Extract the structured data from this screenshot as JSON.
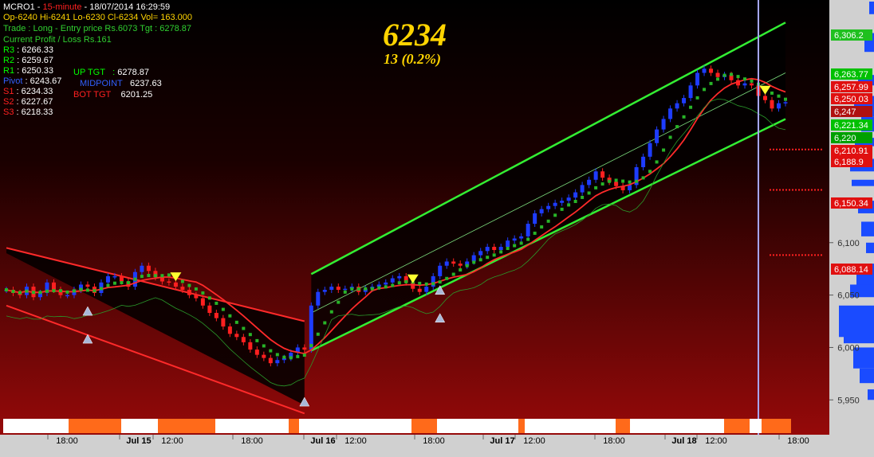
{
  "header": {
    "symbol": "MCRO1",
    "interval": "15-minute",
    "timestamp": "18/07/2014 16:29:59",
    "ohlc": "Op-6240  Hi-6241  Lo-6230  Cl-6234  Vol=  163.000",
    "trade": "Trade : Long - Entry price Rs.6073 Tgt : 6278.87",
    "profit": "Current Profit / Loss Rs.161"
  },
  "levels": [
    {
      "label": "R3",
      "value": "6266.33",
      "color": "#00ff00"
    },
    {
      "label": "R2",
      "value": "6259.67",
      "color": "#00ff00"
    },
    {
      "label": "R1",
      "value": "6250.33",
      "color": "#00ff00"
    },
    {
      "label": "Pivot",
      "value": "6243.67",
      "color": "#3060ff"
    },
    {
      "label": "S1",
      "value": "6234.33",
      "color": "#ff2020"
    },
    {
      "label": "S2",
      "value": "6227.67",
      "color": "#ff2020"
    },
    {
      "label": "S3",
      "value": "6218.33",
      "color": "#ff2020"
    }
  ],
  "targets": {
    "up_label": "UP TGT",
    "up_value": "6278.87",
    "mid_label": "MIDPOINT",
    "mid_value": "6237.63",
    "bot_label": "BOT TGT",
    "bot_value": "6201.25"
  },
  "last_price": {
    "value": "6234",
    "change": "13  (0.2%)"
  },
  "colors": {
    "background_top": "#000000",
    "background_bottom": "#a00a0a",
    "up_candle": "#1e3cff",
    "down_candle": "#ff2020",
    "channel": "#33ee33",
    "channel_down": "#ff2a2a",
    "volume_profile": "#1a4bff",
    "price_label_text": "#ffffff"
  },
  "chart_data": {
    "type": "line",
    "title": "",
    "y_axis_side": "right",
    "ylim": [
      5935,
      6330
    ],
    "yticks": [
      5950,
      6000,
      6050,
      6100
    ],
    "ytick_labels": [
      "5,950",
      "6,000",
      "6,050",
      "6,100"
    ],
    "x_tick_labels": [
      "18:00",
      "Jul 15",
      "12:00",
      "18:00",
      "Jul 16",
      "12:00",
      "18:00",
      "Jul 17",
      "12:00",
      "18:00",
      "Jul 18",
      "12:00",
      "18:00"
    ],
    "price_labels": [
      {
        "text": "6,306.2",
        "value": 6306.2,
        "color": "#1fc01f"
      },
      {
        "text": "6,263.77",
        "value": 6263.77,
        "color": "#00c000"
      },
      {
        "text": "6,257.99",
        "value": 6257.99,
        "color": "#e01010"
      },
      {
        "text": "6,250.03",
        "value": 6250.03,
        "color": "#e01010"
      },
      {
        "text": "6,247",
        "value": 6247,
        "color": "#b01010"
      },
      {
        "text": "6,221.34",
        "value": 6221.34,
        "color": "#00c000"
      },
      {
        "text": "6,220",
        "value": 6220,
        "color": "#00a000"
      },
      {
        "text": "6,210.91",
        "value": 6210.91,
        "color": "#e01010"
      },
      {
        "text": "6,188.9",
        "value": 6188.9,
        "color": "#e01010"
      },
      {
        "text": "6,150.34",
        "value": 6150.34,
        "color": "#e01010"
      },
      {
        "text": "6,088.14",
        "value": 6088.14,
        "color": "#e01010"
      }
    ],
    "session_start_index": 45,
    "markers": [
      {
        "type": "buy",
        "index": 12
      },
      {
        "type": "buy",
        "index": 12
      },
      {
        "type": "sell",
        "index": 25
      },
      {
        "type": "buy",
        "index": 44
      },
      {
        "type": "sell",
        "index": 60
      },
      {
        "type": "buy",
        "index": 64
      },
      {
        "type": "buy",
        "index": 64
      },
      {
        "type": "sell",
        "index": 112
      }
    ],
    "close": [
      6055,
      6052,
      6050,
      6058,
      6048,
      6052,
      6062,
      6055,
      6050,
      6050,
      6055,
      6060,
      6058,
      6052,
      6062,
      6068,
      6068,
      6063,
      6058,
      6072,
      6078,
      6073,
      6067,
      6063,
      6062,
      6058,
      6055,
      6050,
      6047,
      6040,
      6033,
      6028,
      6020,
      6013,
      6010,
      6005,
      5998,
      5993,
      5990,
      5985,
      5988,
      5990,
      5995,
      6000,
      5998,
      6040,
      6053,
      6055,
      6058,
      6055,
      6056,
      6058,
      6053,
      6056,
      6058,
      6060,
      6062,
      6066,
      6068,
      6062,
      6056,
      6053,
      6058,
      6068,
      6078,
      6082,
      6080,
      6078,
      6082,
      6088,
      6092,
      6096,
      6093,
      6096,
      6102,
      6104,
      6106,
      6118,
      6128,
      6132,
      6135,
      6138,
      6140,
      6143,
      6148,
      6155,
      6160,
      6168,
      6162,
      6158,
      6154,
      6150,
      6155,
      6172,
      6182,
      6195,
      6208,
      6218,
      6228,
      6233,
      6238,
      6250,
      6262,
      6266,
      6262,
      6258,
      6260,
      6255,
      6250,
      6252,
      6250,
      6240,
      6236,
      6228,
      6233,
      6234
    ]
  }
}
